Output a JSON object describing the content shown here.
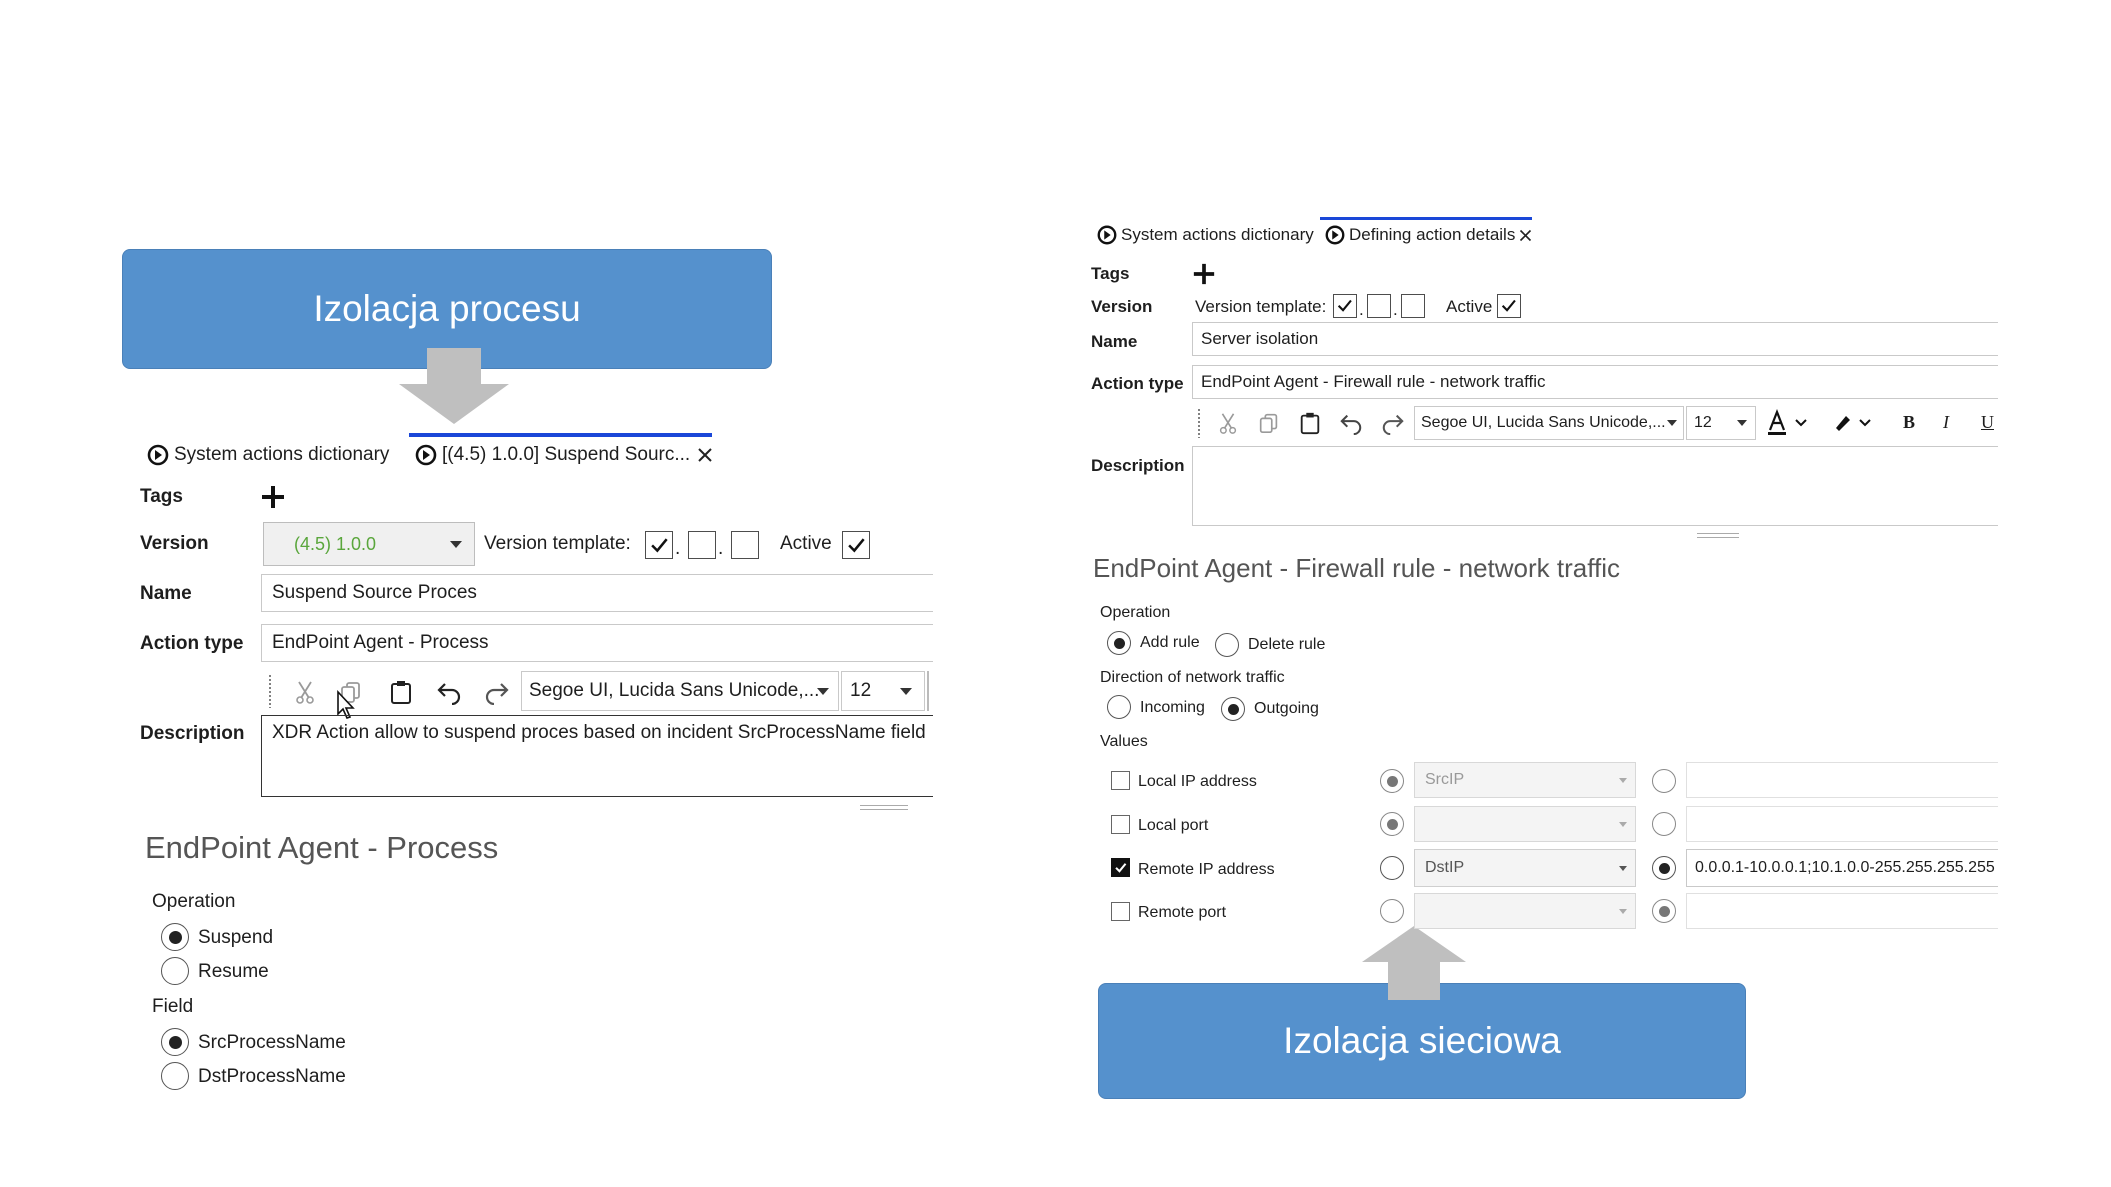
{
  "colors": {
    "callout_bg": "#5591cd",
    "tab_active_underline": "#1a47d8",
    "version_value": "#5aa63c"
  },
  "callouts": {
    "left": "Izolacja procesu",
    "right": "Izolacja sieciowa"
  },
  "left_panel": {
    "tabs": {
      "dictionary": "System actions dictionary",
      "active": "[(4.5) 1.0.0] Suspend Sourc...",
      "icon": "refresh-circle-icon"
    },
    "labels": {
      "tags": "Tags",
      "version": "Version",
      "name": "Name",
      "action_type": "Action type",
      "description": "Description"
    },
    "version_value": "(4.5) 1.0.0",
    "version_template_label": "Version template:",
    "active_label": "Active",
    "name_value": "Suspend Source Proces",
    "action_type_value": "EndPoint Agent - Process",
    "font_value": "Segoe UI, Lucida Sans Unicode,...",
    "font_size_value": "12",
    "description_value": "XDR Action allow to suspend proces based on incident SrcProcessName field",
    "section_title": "EndPoint Agent - Process",
    "operation_label": "Operation",
    "operation_options": [
      "Suspend",
      "Resume"
    ],
    "field_label": "Field",
    "field_options": [
      "SrcProcessName",
      "DstProcessName"
    ]
  },
  "right_panel": {
    "tabs": {
      "dictionary": "System actions dictionary",
      "active": "Defining action details"
    },
    "labels": {
      "tags": "Tags",
      "version": "Version",
      "name": "Name",
      "action_type": "Action type",
      "description": "Description"
    },
    "version_template_label": "Version template:",
    "active_label": "Active",
    "name_value": "Server isolation",
    "action_type_value": "EndPoint Agent - Firewall rule - network traffic",
    "font_value": "Segoe UI, Lucida Sans Unicode,...",
    "font_size_value": "12",
    "toolbar": {
      "bold": "B",
      "italic": "I",
      "underline": "U"
    },
    "section_title": "EndPoint Agent - Firewall rule - network traffic",
    "operation_label": "Operation",
    "operation_options": [
      "Add rule",
      "Delete rule"
    ],
    "direction_label": "Direction of network traffic",
    "direction_options": [
      "Incoming",
      "Outgoing"
    ],
    "values_label": "Values",
    "values_rows": [
      {
        "label": "Local IP address",
        "checked": false,
        "dropdown": "SrcIP",
        "text": ""
      },
      {
        "label": "Local port",
        "checked": false,
        "dropdown": "",
        "text": ""
      },
      {
        "label": "Remote IP address",
        "checked": true,
        "dropdown": "DstIP",
        "text": "0.0.0.1-10.0.0.1;10.1.0.0-255.255.255.255"
      },
      {
        "label": "Remote port",
        "checked": false,
        "dropdown": "",
        "text": ""
      }
    ]
  }
}
